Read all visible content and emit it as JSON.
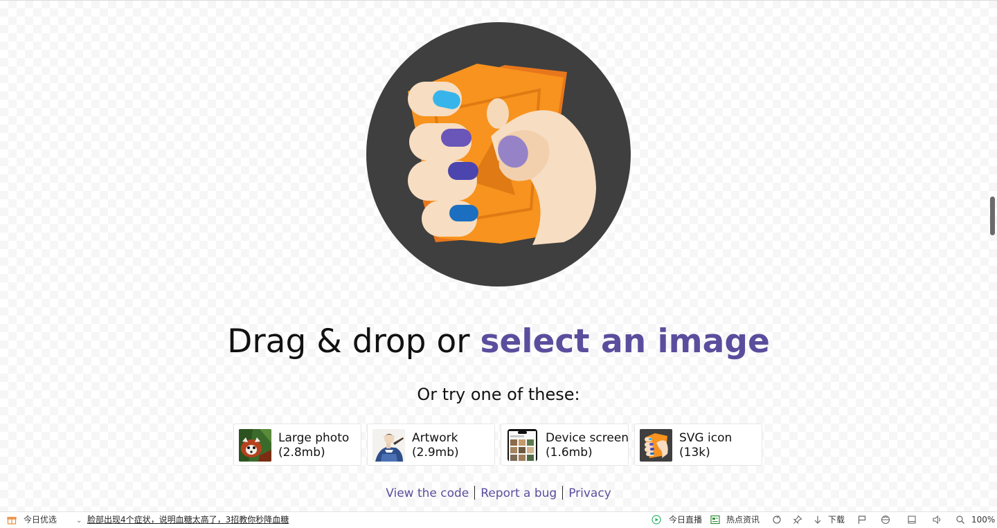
{
  "headline": {
    "prefix": "Drag & drop or ",
    "link": "select an image"
  },
  "subhead": "Or try one of these:",
  "demos": [
    {
      "name": "Large photo",
      "size": "(2.8mb)",
      "icon": "red-panda-thumbnail"
    },
    {
      "name": "Artwork",
      "size": "(2.9mb)",
      "icon": "artwork-thumbnail"
    },
    {
      "name": "Device screen",
      "size": "(1.6mb)",
      "icon": "device-screen-thumbnail"
    },
    {
      "name": "SVG icon",
      "size": "(13k)",
      "icon": "squoosh-logo-thumbnail"
    }
  ],
  "footer": {
    "links": [
      "View the code",
      "Report a bug",
      "Privacy"
    ]
  },
  "status_bar": {
    "today_pick": "今日优选",
    "news": "脸部出现4个症状，说明血糖太高了，3招教你秒降血糖",
    "live": "今日直播",
    "hot_news": "热点资讯",
    "download": "下载",
    "zoom": "100%"
  },
  "colors": {
    "accent": "#5b4d9d",
    "logo_bg": "#3f3f3f",
    "orange": "#f7931e"
  }
}
